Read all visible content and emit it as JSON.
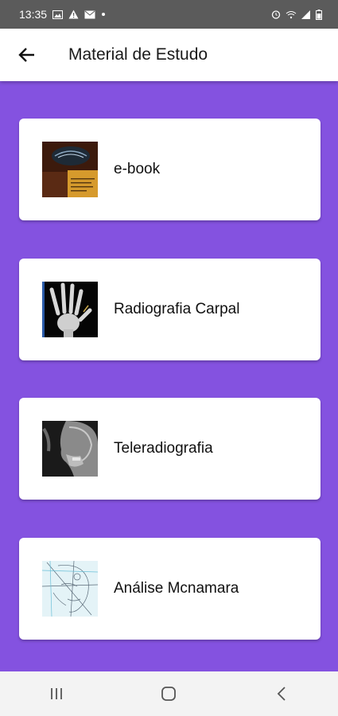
{
  "status_bar": {
    "time": "13:35"
  },
  "app_bar": {
    "title": "Material de Estudo"
  },
  "items": [
    {
      "label": "e-book"
    },
    {
      "label": "Radiografia Carpal"
    },
    {
      "label": "Teleradiografia"
    },
    {
      "label": "Análise Mcnamara"
    }
  ],
  "colors": {
    "background": "#8452e0",
    "card": "#ffffff",
    "status_bar": "#5b5b5b",
    "nav_bar": "#f3f3f3"
  }
}
